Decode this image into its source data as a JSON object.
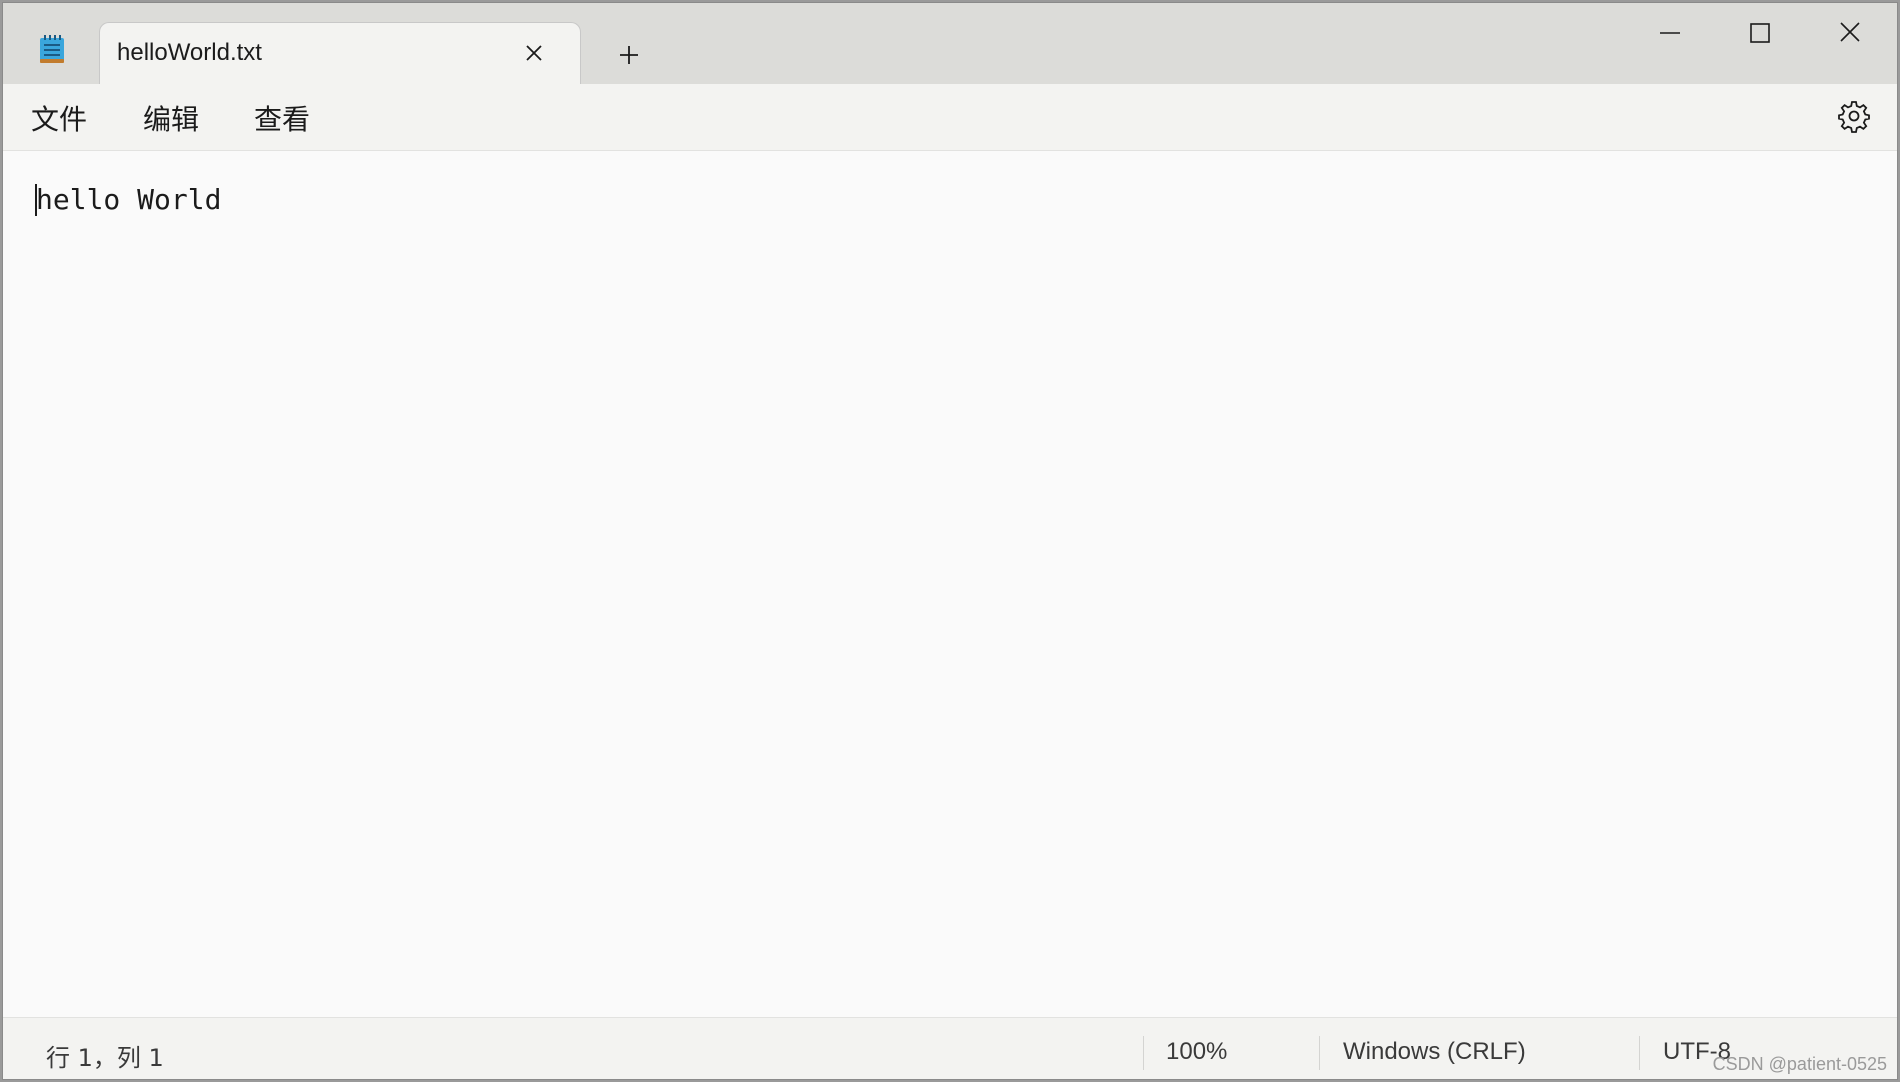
{
  "tab": {
    "title": "helloWorld.txt",
    "close_icon": "close-icon",
    "new_tab_icon": "plus-icon"
  },
  "app_icon": "notepad-icon",
  "window_controls": [
    "minimize-icon",
    "maximize-icon",
    "close-icon"
  ],
  "menu": {
    "file": "文件",
    "edit": "编辑",
    "view": "查看",
    "settings_icon": "gear-icon"
  },
  "editor": {
    "content": "hello World"
  },
  "status": {
    "position": "行 1，列 1",
    "zoom": "100%",
    "line_ending": "Windows (CRLF)",
    "encoding": "UTF-8"
  },
  "watermark": "CSDN @patient-0525",
  "colors": {
    "titlebar": "#dcdcd9",
    "tab": "#f3f3f1",
    "editor_bg": "#fafafa",
    "icon_blue": "#3aa6dc"
  }
}
